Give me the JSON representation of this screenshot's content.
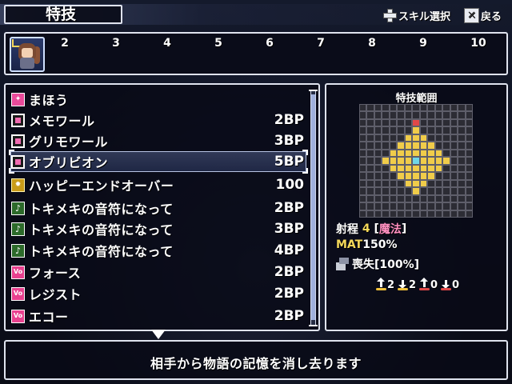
{
  "header": {
    "title": "特技",
    "hints": [
      {
        "icon": "dpad-icon",
        "label": "スキル選択"
      },
      {
        "icon": "x-button-icon",
        "label": "戻る"
      }
    ]
  },
  "party": {
    "slot_numbers": [
      "2",
      "3",
      "4",
      "5",
      "6",
      "7",
      "8",
      "9",
      "10"
    ],
    "active_slot": 1
  },
  "skills": [
    {
      "icon": "magic-category-icon",
      "name": "まほう",
      "cost": ""
    },
    {
      "icon": "skill-box-icon",
      "name": "メモワール",
      "cost": "2BP"
    },
    {
      "icon": "skill-box-icon",
      "name": "グリモワール",
      "cost": "3BP"
    },
    {
      "icon": "skill-box-icon",
      "name": "オブリビオン",
      "cost": "5BP"
    },
    {
      "icon": "gold-gear-icon",
      "name": "ハッピーエンドオーバー",
      "cost": "100"
    },
    {
      "icon": "music-note-icon",
      "name": "トキメキの音符になって",
      "cost": "2BP"
    },
    {
      "icon": "music-note-icon",
      "name": "トキメキの音符になって",
      "cost": "3BP"
    },
    {
      "icon": "music-note-icon",
      "name": "トキメキの音符になって",
      "cost": "4BP"
    },
    {
      "icon": "vo-icon",
      "name": "フォース",
      "cost": "2BP"
    },
    {
      "icon": "vo-icon",
      "name": "レジスト",
      "cost": "2BP"
    },
    {
      "icon": "vo-icon",
      "name": "エコー",
      "cost": "2BP"
    }
  ],
  "selected_index": 3,
  "range": {
    "title": "特技範囲",
    "grid_size": 15,
    "area_cells": [
      [
        7,
        3
      ],
      [
        6,
        4
      ],
      [
        7,
        4
      ],
      [
        8,
        4
      ],
      [
        5,
        5
      ],
      [
        6,
        5
      ],
      [
        7,
        5
      ],
      [
        8,
        5
      ],
      [
        9,
        5
      ],
      [
        4,
        6
      ],
      [
        5,
        6
      ],
      [
        6,
        6
      ],
      [
        7,
        6
      ],
      [
        8,
        6
      ],
      [
        9,
        6
      ],
      [
        10,
        6
      ],
      [
        3,
        7
      ],
      [
        4,
        7
      ],
      [
        5,
        7
      ],
      [
        6,
        7
      ],
      [
        8,
        7
      ],
      [
        9,
        7
      ],
      [
        10,
        7
      ],
      [
        11,
        7
      ],
      [
        4,
        8
      ],
      [
        5,
        8
      ],
      [
        6,
        8
      ],
      [
        7,
        8
      ],
      [
        8,
        8
      ],
      [
        9,
        8
      ],
      [
        10,
        8
      ],
      [
        5,
        9
      ],
      [
        6,
        9
      ],
      [
        7,
        9
      ],
      [
        8,
        9
      ],
      [
        9,
        9
      ],
      [
        6,
        10
      ],
      [
        7,
        10
      ],
      [
        8,
        10
      ],
      [
        7,
        11
      ]
    ],
    "center_cell": [
      7,
      7
    ],
    "caster_cell": [
      7,
      2
    ],
    "arrows": [
      {
        "direction": "up",
        "color": "#f2c23a",
        "value": "2"
      },
      {
        "direction": "down",
        "color": "#f2c23a",
        "value": "2"
      },
      {
        "direction": "up",
        "color": "#e04848",
        "value": "0"
      },
      {
        "direction": "down",
        "color": "#e04848",
        "value": "0"
      }
    ]
  },
  "stats": {
    "range_label": "射程",
    "range_value": "4",
    "type_open": "[",
    "type_value": "魔法",
    "type_close": "]",
    "mat_label": "MAT",
    "mat_value": "150%",
    "effect_label": "喪失[100%]"
  },
  "description": "相手から物語の記憶を消し去ります",
  "colors": {
    "grid_empty": "#2c2c34",
    "grid_area": "#f0cc4a",
    "grid_center": "#6fd6e8",
    "grid_caster": "#e04848",
    "accent_yellow": "#f5d95a",
    "accent_pink": "#ff8fc0"
  }
}
